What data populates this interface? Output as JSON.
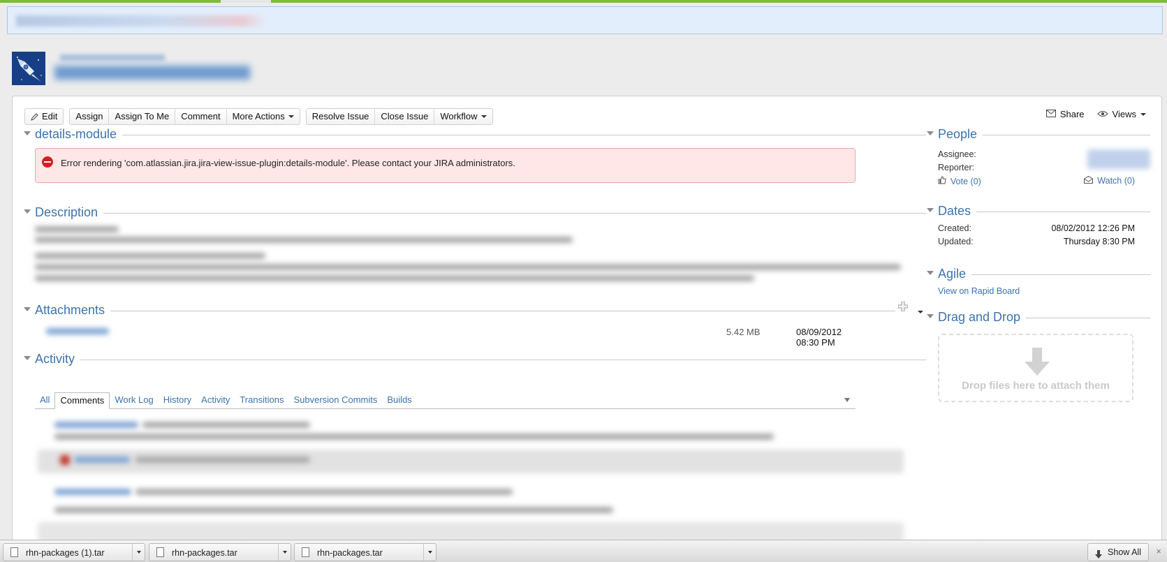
{
  "toolbar": {
    "edit": "Edit",
    "assign": "Assign",
    "assign_to_me": "Assign To Me",
    "comment": "Comment",
    "more_actions": "More Actions",
    "resolve_issue": "Resolve Issue",
    "close_issue": "Close Issue",
    "workflow": "Workflow",
    "share": "Share",
    "views": "Views"
  },
  "modules": {
    "details": {
      "title": "details-module",
      "error": "Error rendering 'com.atlassian.jira.jira-view-issue-plugin:details-module'. Please contact your JIRA administrators."
    },
    "description": {
      "title": "Description"
    },
    "attachments": {
      "title": "Attachments",
      "size": "5.42 MB",
      "date": "08/09/2012 08:30 PM"
    },
    "activity": {
      "title": "Activity",
      "tabs": [
        "All",
        "Comments",
        "Work Log",
        "History",
        "Activity",
        "Transitions",
        "Subversion Commits",
        "Builds"
      ],
      "active_tab": "Comments"
    }
  },
  "sidebar": {
    "people": {
      "title": "People",
      "assignee_label": "Assignee:",
      "reporter_label": "Reporter:",
      "vote": "Vote (0)",
      "watch": "Watch (0)"
    },
    "dates": {
      "title": "Dates",
      "created_label": "Created:",
      "created_value": "08/02/2012 12:26 PM",
      "updated_label": "Updated:",
      "updated_value": "Thursday 8:30 PM"
    },
    "agile": {
      "title": "Agile",
      "link": "View on Rapid Board"
    },
    "dnd": {
      "title": "Drag and Drop",
      "message": "Drop files here to attach them"
    }
  },
  "downloads": {
    "items": [
      "rhn-packages (1).tar",
      "rhn-packages.tar",
      "rhn-packages.tar"
    ],
    "show_all": "Show All",
    "close": "×"
  },
  "colors": {
    "link": "#3b73af",
    "error_bg": "#ffe7e7",
    "error_icon": "#d41f1f",
    "top_strip": "#7dbb3c"
  }
}
